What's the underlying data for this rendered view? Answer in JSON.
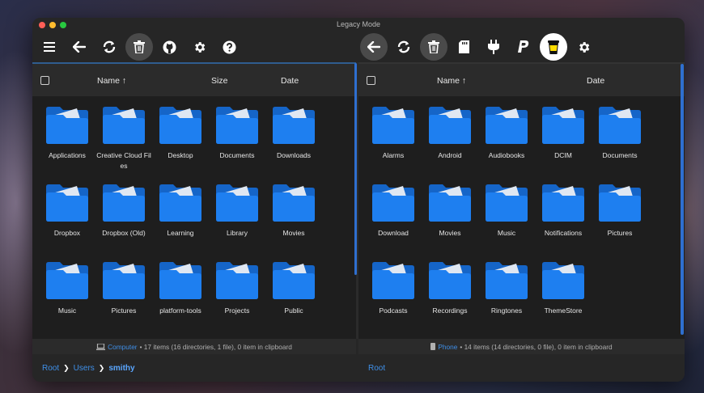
{
  "window": {
    "title": "Legacy Mode"
  },
  "left_toolbar": [
    "menu-icon",
    "back-arrow-icon",
    "refresh-icon",
    "trash-icon",
    "github-icon",
    "gear-icon",
    "help-icon"
  ],
  "right_toolbar": [
    "back-arrow-icon",
    "refresh-icon",
    "trash-icon",
    "sd-card-icon",
    "plug-icon",
    "paypal-icon",
    "buymeacoffee-icon",
    "gear-icon"
  ],
  "left_pane": {
    "headers": {
      "name": "Name ↑",
      "size": "Size",
      "date": "Date"
    },
    "folders": [
      "Applications",
      "Creative Cloud Files",
      "Desktop",
      "Documents",
      "Downloads",
      "Dropbox",
      "Dropbox (Old)",
      "Learning",
      "Library",
      "Movies",
      "Music",
      "Pictures",
      "platform-tools",
      "Projects",
      "Public"
    ],
    "status": {
      "device": "Computer",
      "text": "• 17 items (16 directories, 1 file), 0 item in clipboard"
    },
    "breadcrumb": [
      "Root",
      "Users",
      "smithy"
    ]
  },
  "right_pane": {
    "headers": {
      "name": "Name ↑",
      "date": "Date"
    },
    "folders": [
      "Alarms",
      "Android",
      "Audiobooks",
      "DCIM",
      "Documents",
      "Download",
      "Movies",
      "Music",
      "Notifications",
      "Pictures",
      "Podcasts",
      "Recordings",
      "Ringtones",
      "ThemeStore"
    ],
    "status": {
      "device": "Phone",
      "text": "• 14 items (14 directories, 0 file), 0 item in clipboard"
    },
    "breadcrumb": [
      "Root"
    ]
  },
  "colors": {
    "accent": "#2f6fd0",
    "folder": "#1e7ff0",
    "link": "#3f8fe8"
  }
}
